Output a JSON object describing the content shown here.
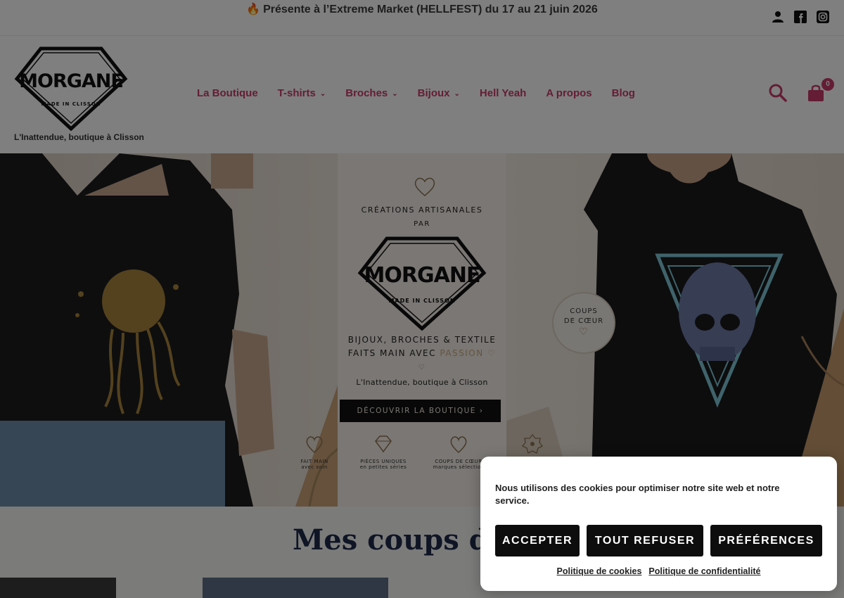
{
  "announcement": {
    "icon": "flame-icon",
    "text": "Présente à l’Extreme Market (HELLFEST) du 17 au 21 juin 2026"
  },
  "top_icons": [
    "user-icon",
    "facebook-icon",
    "instagram-icon"
  ],
  "header": {
    "logo_text": "MORGANE",
    "logo_subtext": "MADE IN CLISSON",
    "tagline": "L'Inattendue, boutique à Clisson",
    "nav": [
      {
        "label": "La Boutique",
        "has_dropdown": false
      },
      {
        "label": "T-shirts",
        "has_dropdown": true
      },
      {
        "label": "Broches",
        "has_dropdown": true
      },
      {
        "label": "Bijoux",
        "has_dropdown": true
      },
      {
        "label": "Hell Yeah",
        "has_dropdown": false
      },
      {
        "label": "A propos",
        "has_dropdown": false
      },
      {
        "label": "Blog",
        "has_dropdown": false
      }
    ],
    "cart_count": "0",
    "accent_color": "#c83a6a"
  },
  "hero": {
    "line1": "CRÉATIONS ARTISANALES",
    "line2": "PAR",
    "logo_text": "MORGANE",
    "logo_subtext": "MADE IN CLISSON",
    "tagline_a": "BIJOUX, BROCHES & TEXTILE",
    "tagline_b_prefix": "FAITS MAIN AVEC",
    "tagline_b_accent": "PASSION",
    "shop": "L'Inattendue, boutique à Clisson",
    "cta": "DÉCOUVRIR LA BOUTIQUE ›",
    "badge_line1": "COUPS",
    "badge_line2": "DE CŒUR",
    "features": [
      {
        "title": "FAIT MAIN",
        "sub": "avec soin",
        "icon": "heart-icon"
      },
      {
        "title": "PIÈCES UNIQUES",
        "sub": "en petites séries",
        "icon": "diamond-icon"
      },
      {
        "title": "COUPS DE CŒUR",
        "sub": "marques sélection",
        "icon": "heart-icon"
      },
      {
        "title": "",
        "sub": "",
        "icon": "flower-badge-icon"
      }
    ]
  },
  "section": {
    "title": "Mes coups de c"
  },
  "cookie": {
    "message": "Nous utilisons des cookies pour optimiser notre site web et notre service.",
    "accept": "ACCEPTER",
    "refuse": "TOUT REFUSER",
    "preferences": "PRÉFÉRENCES",
    "link_cookies": "Politique de cookies",
    "link_privacy": "Politique de confidentialité"
  }
}
